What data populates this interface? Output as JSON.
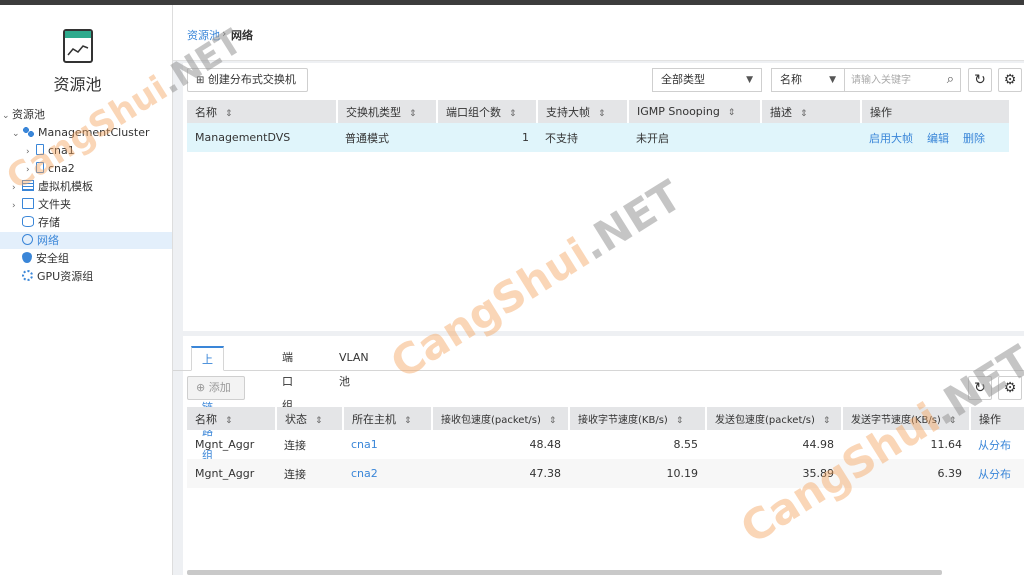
{
  "sidebar": {
    "title": "资源池",
    "tree": [
      {
        "label": "资源池"
      },
      {
        "label": "ManagementCluster"
      },
      {
        "label": "cna1"
      },
      {
        "label": "cna2"
      },
      {
        "label": "虚拟机模板"
      },
      {
        "label": "文件夹"
      },
      {
        "label": "存储"
      },
      {
        "label": "网络"
      },
      {
        "label": "安全组"
      },
      {
        "label": "GPU资源组"
      }
    ]
  },
  "breadcrumb": {
    "parent": "资源池",
    "sep": "›",
    "current": "网络"
  },
  "toolbar": {
    "create_label": "创建分布式交换机",
    "type_filter": "全部类型",
    "field_select": "名称",
    "search_placeholder": "请输入关键字",
    "refresh_icon": "refresh-icon",
    "settings_icon": "gear-icon"
  },
  "switch_table": {
    "headers": [
      "名称",
      "交换机类型",
      "端口组个数",
      "支持大帧",
      "IGMP Snooping",
      "描述",
      "操作"
    ],
    "rows": [
      {
        "name": "ManagementDVS",
        "type": "普通模式",
        "ports": "1",
        "jumbo": "不支持",
        "igmp": "未开启",
        "desc": "",
        "actions": [
          "启用大帧",
          "编辑",
          "删除"
        ]
      }
    ]
  },
  "tabs": [
    "上行链路组",
    "端口组",
    "VLAN池"
  ],
  "uplink": {
    "add_label": "添加",
    "headers": [
      "名称",
      "状态",
      "所在主机",
      "接收包速度(packet/s)",
      "接收字节速度(KB/s)",
      "发送包速度(packet/s)",
      "发送字节速度(KB/s)",
      "操作"
    ],
    "rows": [
      {
        "name": "Mgnt_Aggr",
        "status": "连接",
        "host": "cna1",
        "rx_pkt": "48.48",
        "rx_kb": "8.55",
        "tx_pkt": "44.98",
        "tx_kb": "11.64",
        "action": "从分布"
      },
      {
        "name": "Mgnt_Aggr",
        "status": "连接",
        "host": "cna2",
        "rx_pkt": "47.38",
        "rx_kb": "10.19",
        "tx_pkt": "35.89",
        "tx_kb": "6.39",
        "action": "从分布"
      }
    ]
  },
  "watermark": {
    "a": "Cang",
    "b": "Shui",
    "c": ".NET"
  },
  "colors": {
    "accent": "#3a86d8",
    "highlight_row": "#e0f5fb",
    "logo_band": "#2eaa8d"
  }
}
